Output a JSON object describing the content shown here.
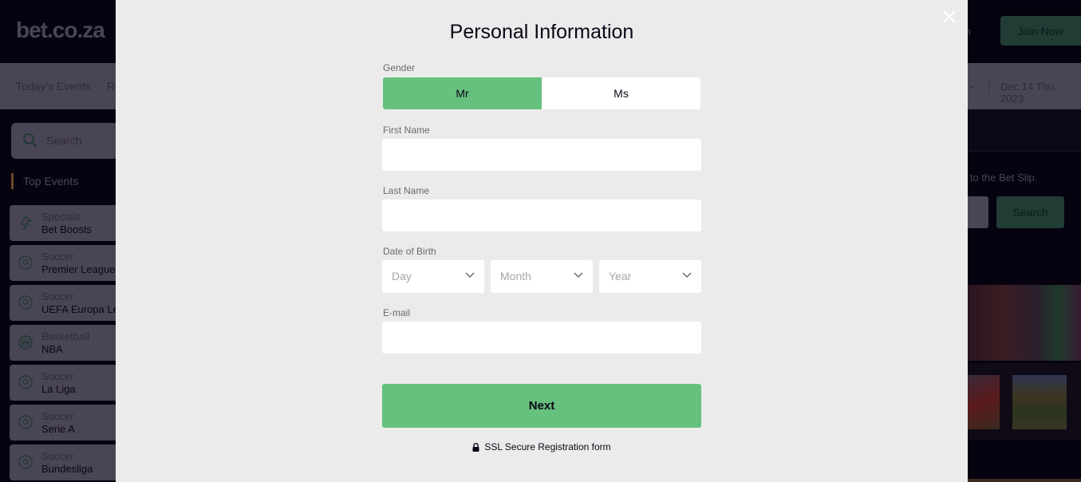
{
  "background_site": {
    "logo_text": "bet.co.za",
    "header": {
      "login_label": "gin",
      "join_label": "Join Now"
    },
    "nav": {
      "items": [
        "Today's Events",
        "Re"
      ],
      "date": "Dec 14 Thu, 2023"
    },
    "sidebar": {
      "search_placeholder": "Search",
      "section_title": "Top Events",
      "events": [
        {
          "sport": "Specials",
          "league": "Bet Boosts",
          "icon": "boost-icon"
        },
        {
          "sport": "Soccer",
          "league": "Premier League",
          "icon": "soccer-ball-icon"
        },
        {
          "sport": "Soccer",
          "league": "UEFA Europa League",
          "icon": "soccer-ball-icon"
        },
        {
          "sport": "Basketball",
          "league": "NBA",
          "icon": "basketball-icon"
        },
        {
          "sport": "Soccer",
          "league": "La Liga",
          "icon": "soccer-ball-icon"
        },
        {
          "sport": "Soccer",
          "league": "Serie A",
          "icon": "soccer-ball-icon"
        },
        {
          "sport": "Soccer",
          "league": "Bundesliga",
          "icon": "soccer-ball-icon"
        }
      ]
    },
    "betslip": {
      "hint_text": "n to the Bet Slip.",
      "search_label": "Search"
    }
  },
  "modal": {
    "title": "Personal Information",
    "gender": {
      "label": "Gender",
      "options": [
        "Mr",
        "Ms"
      ],
      "selected": "Mr"
    },
    "first_name": {
      "label": "First Name",
      "value": ""
    },
    "last_name": {
      "label": "Last Name",
      "value": ""
    },
    "dob": {
      "label": "Date of Birth",
      "day_placeholder": "Day",
      "month_placeholder": "Month",
      "year_placeholder": "Year"
    },
    "email": {
      "label": "E-mail",
      "value": ""
    },
    "next_label": "Next",
    "ssl_text": "SSL Secure Registration form"
  },
  "colors": {
    "accent_green": "#65c17d",
    "modal_bg": "#ebebeb",
    "site_bg": "#07020f"
  }
}
